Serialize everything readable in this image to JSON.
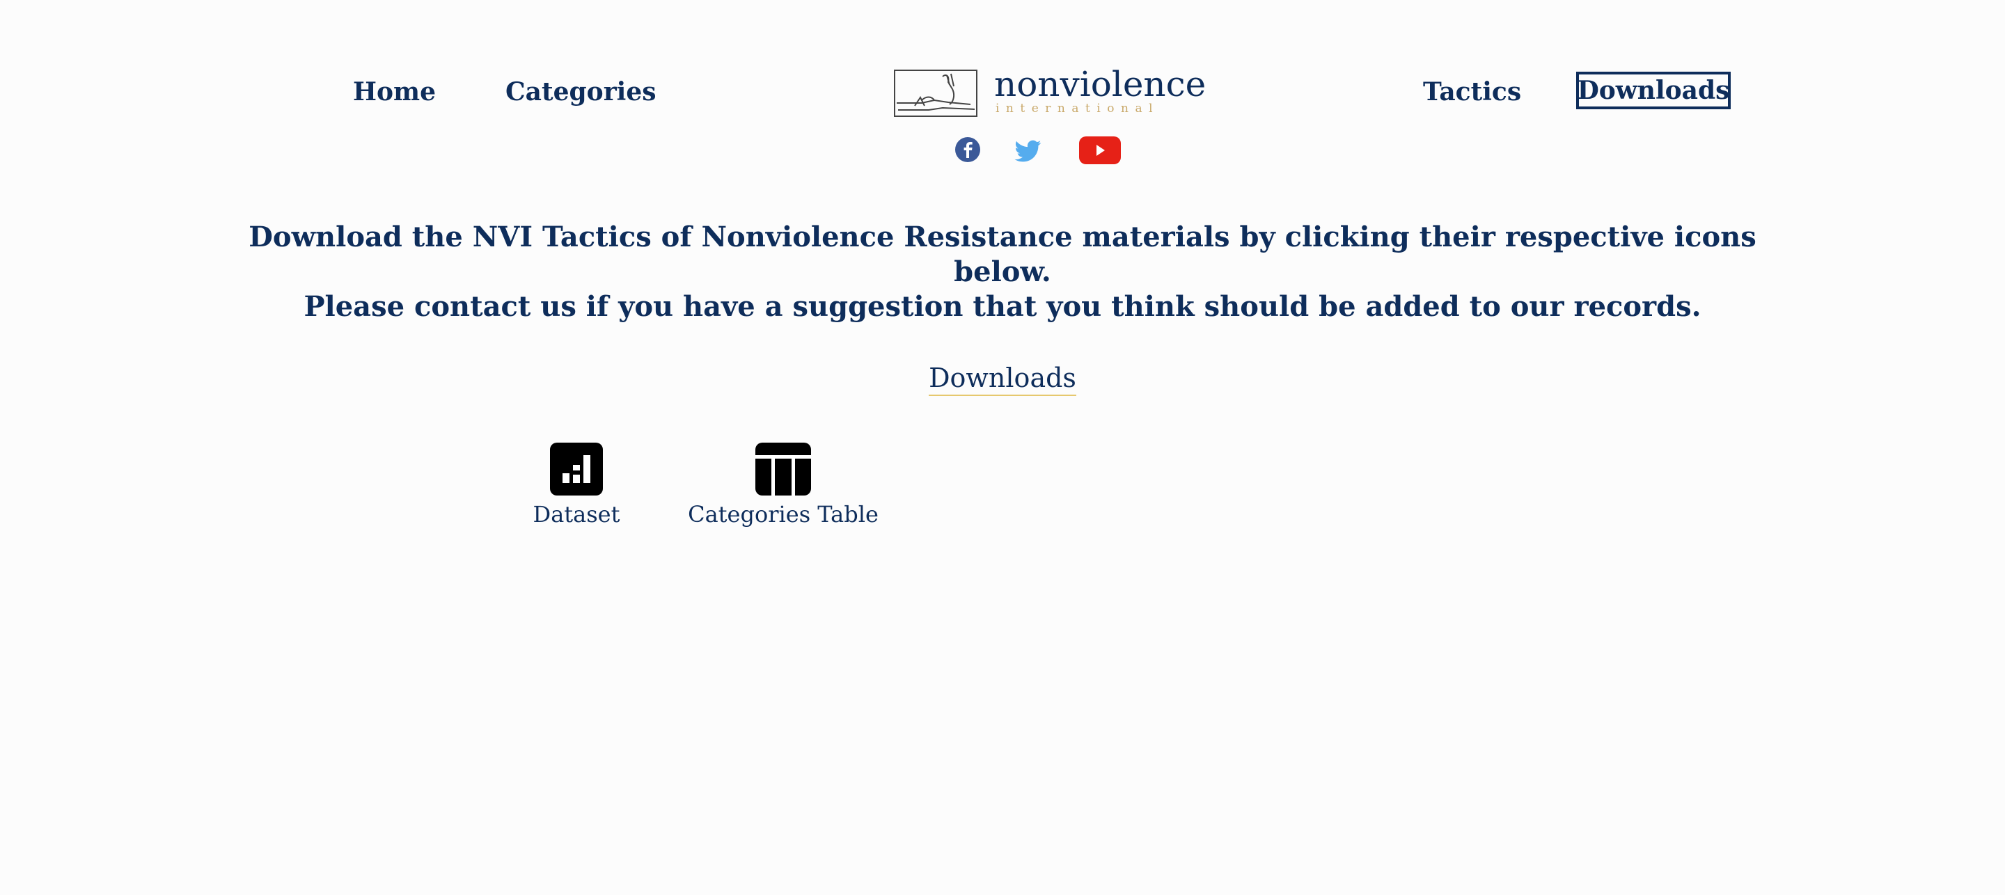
{
  "nav": {
    "home": "Home",
    "categories": "Categories",
    "tactics": "Tactics",
    "downloads": "Downloads"
  },
  "logo": {
    "name": "nonviolence",
    "subtitle": "international"
  },
  "social": {
    "facebook": "facebook-icon",
    "twitter": "twitter-icon",
    "youtube": "youtube-icon"
  },
  "intro": {
    "line1": "Download the NVI Tactics of Nonviolence Resistance materials by clicking their respective icons below.",
    "line2": "Please contact us if you have a suggestion that you think should be added to our records."
  },
  "downloads_section": {
    "title": "Downloads",
    "items": [
      {
        "label": "Dataset",
        "icon": "chart-icon"
      },
      {
        "label": "Categories Table",
        "icon": "table-icon"
      }
    ]
  },
  "colors": {
    "primary": "#0e2d5b",
    "accent": "#c9a96a",
    "facebook": "#3b5998",
    "twitter": "#55acee",
    "youtube": "#e62117",
    "background": "#fcfcfc"
  }
}
